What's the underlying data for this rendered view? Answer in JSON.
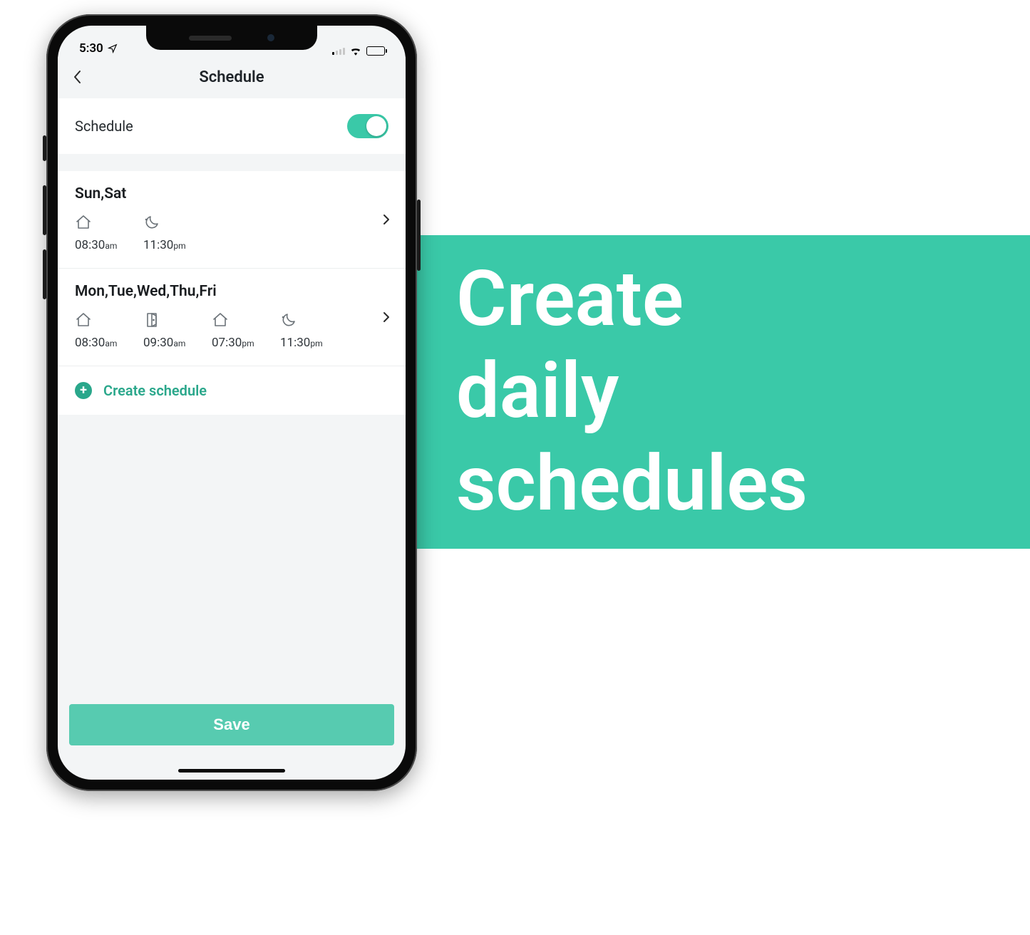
{
  "banner": {
    "text": "Create\ndaily\nschedules"
  },
  "status": {
    "time": "5:30"
  },
  "header": {
    "title": "Schedule"
  },
  "toggle": {
    "label": "Schedule",
    "enabled": true
  },
  "schedules": [
    {
      "days": "Sun,Sat",
      "slots": [
        {
          "icon": "home-icon",
          "time": "08:30",
          "ampm": "am"
        },
        {
          "icon": "moon-icon",
          "time": "11:30",
          "ampm": "pm"
        }
      ]
    },
    {
      "days": "Mon,Tue,Wed,Thu,Fri",
      "slots": [
        {
          "icon": "home-icon",
          "time": "08:30",
          "ampm": "am"
        },
        {
          "icon": "door-icon",
          "time": "09:30",
          "ampm": "am"
        },
        {
          "icon": "home-icon",
          "time": "07:30",
          "ampm": "pm"
        },
        {
          "icon": "moon-icon",
          "time": "11:30",
          "ampm": "pm"
        }
      ]
    }
  ],
  "create": {
    "label": "Create schedule"
  },
  "save": {
    "label": "Save"
  },
  "colors": {
    "accent": "#3ac9a8",
    "accent_dark": "#2aa78b",
    "save_bg": "#57cbb0"
  }
}
